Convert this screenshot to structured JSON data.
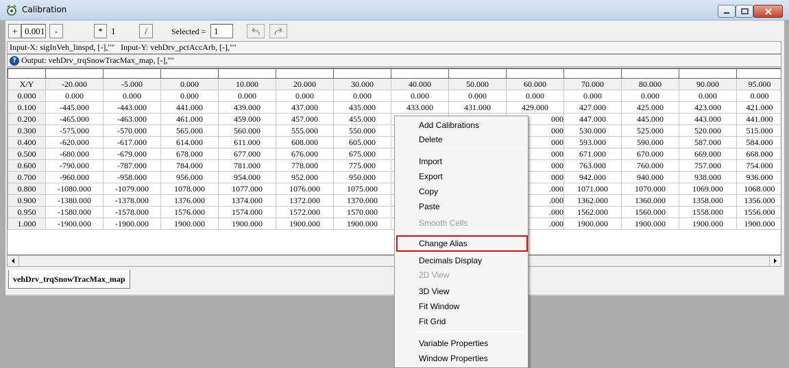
{
  "window": {
    "title": "Calibration"
  },
  "toolbar": {
    "plus_label": "+",
    "step_value": "0.001",
    "minus_label": "-",
    "multiply_label": "*",
    "factor_value": "1",
    "divide_label": "/",
    "selected_label": "Selected =",
    "selected_value": "1",
    "undo_icon": "undo-icon",
    "redo_icon": "redo-icon"
  },
  "inputs_line": "Input-X: sigInVeh_linspd, [-],\"\"   Input-Y: vehDrv_pctAccArb, [-],\"\"",
  "output_line": "Output: vehDrv_trqSnowTracMax_map, [-],\"\"",
  "grid": {
    "corner_label": "X/Y",
    "columns": [
      "-20.000",
      "-5.000",
      "0.000",
      "10.000",
      "20.000",
      "30.000",
      "40.000",
      "50.000",
      "60.000",
      "70.000",
      "80.000",
      "90.000",
      "95.000"
    ],
    "rows": [
      {
        "y": "0.000",
        "cells": [
          "0.000",
          "0.000",
          "0.000",
          "0.000",
          "0.000",
          "0.000",
          "0.000",
          "0.000",
          "0.000",
          "0.000",
          "0.000",
          "0.000",
          "0.000"
        ]
      },
      {
        "y": "0.100",
        "cells": [
          "-445.000",
          "-443.000",
          "441.000",
          "439.000",
          "437.000",
          "435.000",
          "433.000",
          "431.000",
          "429.000",
          "427.000",
          "425.000",
          "423.000",
          "421.000"
        ]
      },
      {
        "y": "0.200",
        "cells": [
          "-465.000",
          "-463.000",
          "461.000",
          "459.000",
          "457.000",
          "455.000",
          "",
          "",
          "000",
          "447.000",
          "445.000",
          "443.000",
          "441.000"
        ]
      },
      {
        "y": "0.300",
        "cells": [
          "-575.000",
          "-570.000",
          "565.000",
          "560.000",
          "555.000",
          "550.000",
          "",
          "",
          "000",
          "530.000",
          "525.000",
          "520.000",
          "515.000"
        ]
      },
      {
        "y": "0.400",
        "cells": [
          "-620.000",
          "-617.000",
          "614.000",
          "611.000",
          "608.000",
          "605.000",
          "",
          "",
          "000",
          "593.000",
          "590.000",
          "587.000",
          "584.000"
        ]
      },
      {
        "y": "0.500",
        "cells": [
          "-680.000",
          "-679.000",
          "678.000",
          "677.000",
          "676.000",
          "675.000",
          "",
          "",
          "000",
          "671.000",
          "670.000",
          "669.000",
          "668.000"
        ]
      },
      {
        "y": "0.600",
        "cells": [
          "-790.000",
          "-787.000",
          "784.000",
          "781.000",
          "778.000",
          "775.000",
          "",
          "",
          "000",
          "763.000",
          "760.000",
          "757.000",
          "754.000"
        ]
      },
      {
        "y": "0.700",
        "cells": [
          "-960.000",
          "-958.000",
          "956.000",
          "954.000",
          "952.000",
          "950.000",
          "",
          "",
          "000",
          "942.000",
          "940.000",
          "938.000",
          "936.000"
        ]
      },
      {
        "y": "0.800",
        "cells": [
          "-1080.000",
          "-1079.000",
          "1078.000",
          "1077.000",
          "1076.000",
          "1075.000",
          "",
          "",
          ".000",
          "1071.000",
          "1070.000",
          "1069.000",
          "1068.000"
        ]
      },
      {
        "y": "0.900",
        "cells": [
          "-1380.000",
          "-1378.000",
          "1376.000",
          "1374.000",
          "1372.000",
          "1370.000",
          "",
          "",
          ".000",
          "1362.000",
          "1360.000",
          "1358.000",
          "1356.000"
        ]
      },
      {
        "y": "0.950",
        "cells": [
          "-1580.000",
          "-1578.000",
          "1576.000",
          "1574.000",
          "1572.000",
          "1570.000",
          "",
          "",
          ".000",
          "1562.000",
          "1560.000",
          "1558.000",
          "1556.000"
        ]
      },
      {
        "y": "1.000",
        "cells": [
          "-1900.000",
          "-1900.000",
          "1900.000",
          "1900.000",
          "1900.000",
          "1900.000",
          "",
          "",
          ".000",
          "1900.000",
          "1900.000",
          "1900.000",
          "1900.000"
        ]
      }
    ]
  },
  "sheet_tab": "vehDrv_trqSnowTracMax_map",
  "context_menu": {
    "items": [
      {
        "label": "Add Calibrations",
        "disabled": false
      },
      {
        "label": "Delete",
        "disabled": false
      },
      {
        "label": "Import",
        "disabled": false
      },
      {
        "label": "Export",
        "disabled": false
      },
      {
        "label": "Copy",
        "disabled": false
      },
      {
        "label": "Paste",
        "disabled": false
      },
      {
        "label": "Smooth Cells",
        "disabled": true
      },
      {
        "label": "Change Alias",
        "disabled": false,
        "highlighted": true
      },
      {
        "label": "Decimals Display",
        "disabled": false
      },
      {
        "label": "2D View",
        "disabled": true
      },
      {
        "label": "3D View",
        "disabled": false
      },
      {
        "label": "Fit Window",
        "disabled": false
      },
      {
        "label": "Fit Grid",
        "disabled": false
      },
      {
        "label": "Variable Properties",
        "disabled": false
      },
      {
        "label": "Window Properties",
        "disabled": false
      }
    ]
  },
  "colors": {
    "highlight_border": "#e01010",
    "close_button": "#c5462f"
  }
}
